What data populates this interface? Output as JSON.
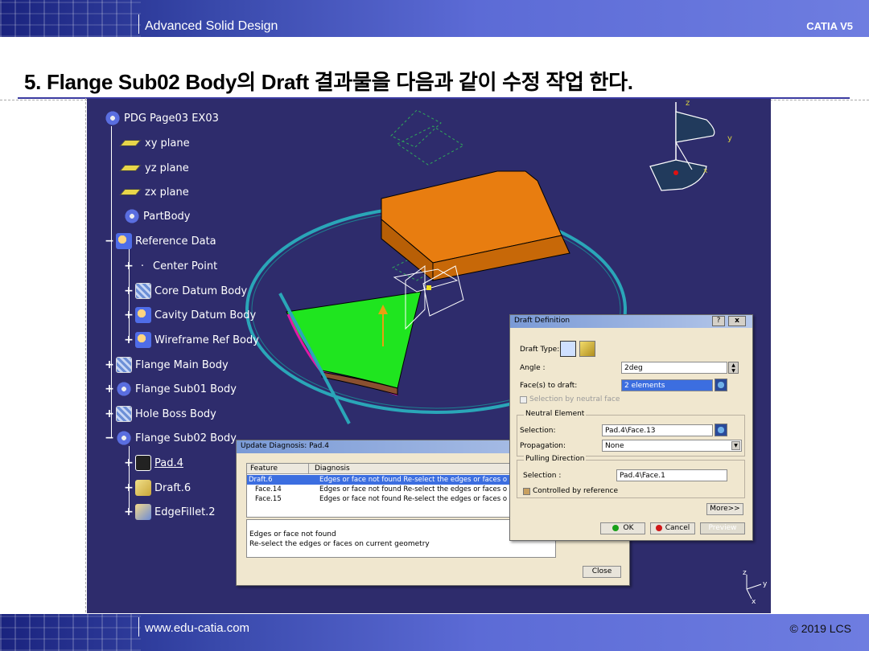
{
  "header": {
    "course": "Advanced Solid Design",
    "brand": "CATIA V5"
  },
  "heading": "5. Flange Sub02 Body의 Draft 결과물을 다음과 같이 수정 작업 한다.",
  "footer": {
    "url": "www.edu-catia.com",
    "copyright": "© 2019 LCS"
  },
  "tree": {
    "root": "PDG Page03 EX03",
    "items": [
      {
        "label": "xy plane"
      },
      {
        "label": "yz plane"
      },
      {
        "label": "zx plane"
      },
      {
        "label": "PartBody"
      },
      {
        "label": "Reference Data"
      },
      {
        "label": "Center Point"
      },
      {
        "label": "Core Datum Body"
      },
      {
        "label": "Cavity Datum Body"
      },
      {
        "label": "Wireframe Ref Body"
      },
      {
        "label": "Flange Main Body"
      },
      {
        "label": "Flange Sub01 Body"
      },
      {
        "label": "Hole Boss Body"
      },
      {
        "label": "Flange Sub02 Body"
      },
      {
        "label": "Pad.4"
      },
      {
        "label": "Draft.6"
      },
      {
        "label": "EdgeFillet.2"
      }
    ]
  },
  "compass": {
    "z": "z",
    "y": "y",
    "x": "x"
  },
  "axis_triad": {
    "z": "z",
    "y": "y",
    "x": "x"
  },
  "draft_dialog": {
    "title": "Draft Definition",
    "help": "?",
    "close": "x",
    "draft_type_label": "Draft Type:",
    "angle_label": "Angle :",
    "angle_value": "2deg",
    "faces_label": "Face(s) to draft:",
    "faces_value": "2 elements",
    "neutral_face_check": "Selection by neutral face",
    "neutral_group": "Neutral Element",
    "selection_label": "Selection:",
    "selection_value": "Pad.4\\Face.13",
    "propagation_label": "Propagation:",
    "propagation_value": "None",
    "pulling_group": "Pulling Direction",
    "pull_selection_label": "Selection :",
    "pull_selection_value": "Pad.4\\Face.1",
    "controlled_label": "Controlled by reference",
    "more": "More>>",
    "ok": "OK",
    "cancel": "Cancel",
    "preview": "Preview"
  },
  "update_dialog": {
    "title": "Update Diagnosis: Pad.4",
    "col_feature": "Feature",
    "col_diagnosis": "Diagnosis",
    "rows": [
      {
        "feature": "Draft.6",
        "diagnosis": "Edges or face not found Re-select the edges or faces o"
      },
      {
        "feature": "Face.14",
        "diagnosis": "Edges or face not found Re-select the edges or faces o"
      },
      {
        "feature": "Face.15",
        "diagnosis": "Edges or face not found Re-select the edges or faces o"
      }
    ],
    "message_line1": "Edges or face not found",
    "message_line2": "Re-select the edges or faces on current geometry",
    "close": "Close"
  }
}
